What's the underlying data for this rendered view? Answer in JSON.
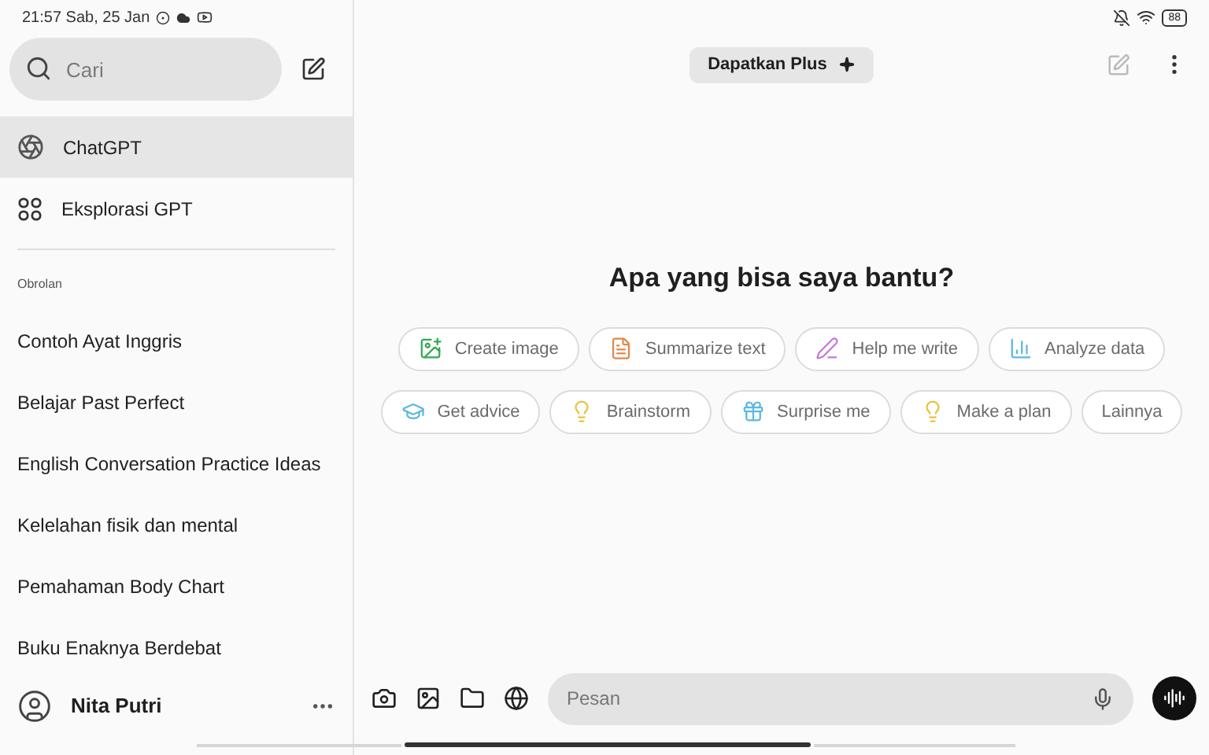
{
  "status_bar": {
    "time": "21:57 Sab, 25 Jan",
    "battery": "88"
  },
  "sidebar": {
    "search": {
      "placeholder": "Cari"
    },
    "nav": [
      {
        "label": "ChatGPT",
        "kind": "logo",
        "selected": true
      },
      {
        "label": "Eksplorasi GPT",
        "kind": "explore",
        "selected": false
      }
    ],
    "section_title": "Obrolan",
    "chats": [
      {
        "label": "Contoh Ayat Inggris",
        "selected": false
      },
      {
        "label": "Belajar Past Perfect",
        "selected": false
      },
      {
        "label": "English Conversation Practice Ideas",
        "selected": false
      },
      {
        "label": "Kelelahan fisik dan mental",
        "selected": false
      },
      {
        "label": "Pemahaman Body Chart",
        "selected": false
      },
      {
        "label": "Buku Enaknya Berdebat",
        "selected": false
      }
    ],
    "user": {
      "name": "Nita Putri"
    }
  },
  "header": {
    "upgrade_button": "Dapatkan Plus"
  },
  "main": {
    "heading": "Apa yang bisa saya bantu?",
    "suggestion_rows": [
      [
        {
          "label": "Create image",
          "kind": "image",
          "color": "#34a853"
        },
        {
          "label": "Summarize text",
          "kind": "summarize",
          "color": "#e2884a"
        },
        {
          "label": "Help me write",
          "kind": "write",
          "color": "#c678dd"
        },
        {
          "label": "Analyze data",
          "kind": "analyze",
          "color": "#5bb8e0"
        }
      ],
      [
        {
          "label": "Get advice",
          "kind": "advice",
          "color": "#5bb8e0"
        },
        {
          "label": "Brainstorm",
          "kind": "idea",
          "color": "#e8c33a"
        },
        {
          "label": "Surprise me",
          "kind": "surprise",
          "color": "#5bb8e0"
        },
        {
          "label": "Make a plan",
          "kind": "idea",
          "color": "#e8c33a"
        },
        {
          "label": "Lainnya",
          "kind": "more"
        }
      ]
    ]
  },
  "composer": {
    "placeholder": "Pesan"
  }
}
